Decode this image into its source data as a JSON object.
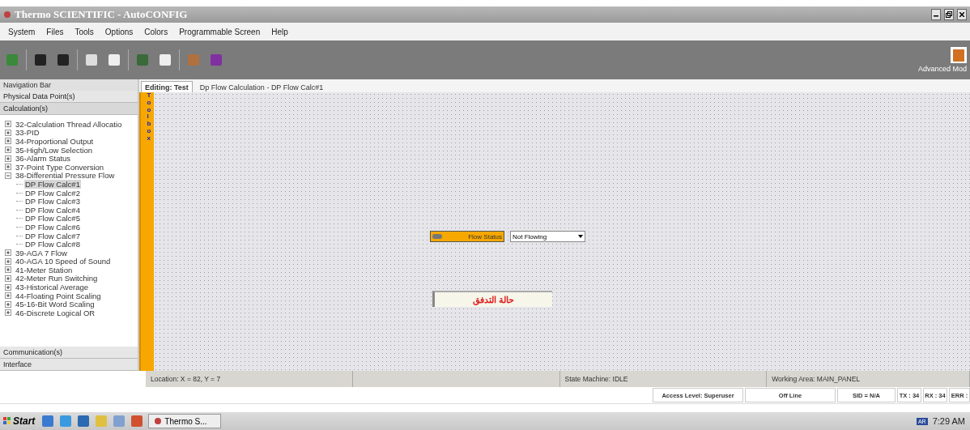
{
  "window": {
    "title": "Thermo SCIENTIFIC - AutoCONFIG"
  },
  "menu": [
    "System",
    "Files",
    "Tools",
    "Options",
    "Colors",
    "Programmable Screen",
    "Help"
  ],
  "toolbar": {
    "mode_label": "Advanced Mod"
  },
  "navigation": {
    "title": "Navigation Bar",
    "sections": [
      {
        "label": "Physical Data Point(s)",
        "expanded": false
      },
      {
        "label": "Calculation(s)",
        "expanded": true,
        "items": [
          {
            "label": "32-Calculation Thread Allocatio",
            "expanded": false,
            "selected": false
          },
          {
            "label": "33-PID",
            "expanded": false,
            "selected": false
          },
          {
            "label": "34-Proportional Output",
            "expanded": false,
            "selected": false
          },
          {
            "label": "35-High/Low Selection",
            "expanded": false,
            "selected": false
          },
          {
            "label": "36-Alarm Status",
            "expanded": false,
            "selected": false
          },
          {
            "label": "37-Point Type Conversion",
            "expanded": false,
            "selected": false
          },
          {
            "label": "38-Differential Pressure Flow",
            "expanded": true,
            "selected": false,
            "children": [
              {
                "label": "DP Flow Calc#1",
                "selected": true
              },
              {
                "label": "DP Flow Calc#2",
                "selected": false
              },
              {
                "label": "DP Flow Calc#3",
                "selected": false
              },
              {
                "label": "DP Flow Calc#4",
                "selected": false
              },
              {
                "label": "DP Flow Calc#5",
                "selected": false
              },
              {
                "label": "DP Flow Calc#6",
                "selected": false
              },
              {
                "label": "DP Flow Calc#7",
                "selected": false
              },
              {
                "label": "DP Flow Calc#8",
                "selected": false
              }
            ]
          },
          {
            "label": "39-AGA 7 Flow",
            "expanded": false,
            "selected": false
          },
          {
            "label": "40-AGA 10 Speed of Sound",
            "expanded": false,
            "selected": false
          },
          {
            "label": "41-Meter Station",
            "expanded": false,
            "selected": false
          },
          {
            "label": "42-Meter Run Switching",
            "expanded": false,
            "selected": false
          },
          {
            "label": "43-Historical Average",
            "expanded": false,
            "selected": false
          },
          {
            "label": "44-Floating Point Scaling",
            "expanded": false,
            "selected": false
          },
          {
            "label": "45-16-Bit Word Scaling",
            "expanded": false,
            "selected": false
          },
          {
            "label": "46-Discrete Logical OR",
            "expanded": false,
            "selected": false
          }
        ]
      },
      {
        "label": "Communication(s)",
        "expanded": false
      },
      {
        "label": "Interface",
        "expanded": false
      }
    ]
  },
  "tabs": [
    {
      "label": "Editing: Test",
      "selected": true
    },
    {
      "label": "Dp Flow Calculation - DP Flow Calc#1",
      "selected": false
    }
  ],
  "toolbox": {
    "label": "Toolbox"
  },
  "canvas": {
    "status_label": "Flow Status",
    "status_value": "Not Flowing",
    "arabic_text": "حالة التدفق"
  },
  "status_bar": [
    "Location: X = 82, Y = 7",
    "State Machine: IDLE",
    "Working Area: MAIN_PANEL"
  ],
  "status_bar_2": [
    "Access Level: Superuser",
    "Off Line",
    "SID = N/A",
    "TX : 34",
    "RX : 34",
    "ERR :"
  ],
  "taskbar": {
    "start": "Start",
    "task": "Thermo S...",
    "language": "AR",
    "clock": "7:29 AM"
  }
}
